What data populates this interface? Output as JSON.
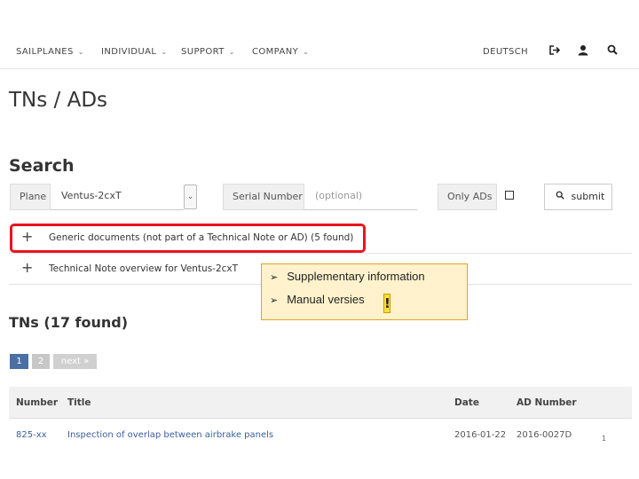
{
  "nav": {
    "items": [
      {
        "label": "SAILPLANES",
        "chevron": "chevron-down-icon"
      },
      {
        "label": "INDIVIDUAL",
        "chevron": "chevron-down-icon"
      },
      {
        "label": "SUPPORT",
        "chevron": "chevron-down-icon"
      },
      {
        "label": "COMPANY",
        "chevron": "chevron-down-icon"
      }
    ],
    "language": "DEUTSCH",
    "icons": [
      "login-icon",
      "user-icon",
      "search-icon"
    ]
  },
  "page_title": "TNs / ADs",
  "search": {
    "title": "Search",
    "plane_label": "Plane",
    "plane_value": "Ventus-2cxT",
    "serial_label": "Serial Number",
    "serial_placeholder": "(optional)",
    "only_ads_label": "Only ADs",
    "only_ads_checked": false,
    "submit_label": "submit"
  },
  "accordion": [
    {
      "icon": "plus-icon",
      "label": "Generic documents (not part of a Technical Note or AD) (5 found)",
      "highlighted": true
    },
    {
      "icon": "plus-icon",
      "label": "Technical Note overview for Ventus-2cxT",
      "highlighted": false
    }
  ],
  "callout": {
    "items": [
      "Supplementary information",
      "Manual versies"
    ],
    "bullet": "arrow-bullet-icon",
    "mark": "!",
    "colors": {
      "background": "#fff2cc",
      "border": "#e2a424",
      "mark": "#ffde3a"
    }
  },
  "tns_title": "TNs (17 found)",
  "pagination": {
    "pages": [
      "1",
      "2"
    ],
    "next": "next »",
    "current": "1"
  },
  "table": {
    "headers": [
      "Number",
      "Title",
      "Date",
      "AD Number"
    ],
    "rows": [
      {
        "number": "825-xx",
        "title": "Inspection of overlap between airbrake panels",
        "date": "2016-01-22",
        "ad_number": "2016-0027D"
      }
    ]
  },
  "slide_number": "1",
  "colors": {
    "highlight": "#e8151c",
    "link": "#3b5fa0",
    "active_page": "#4a6fa5"
  }
}
